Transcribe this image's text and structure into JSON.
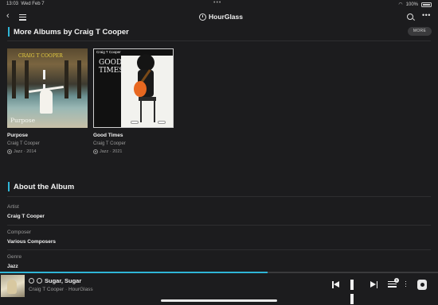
{
  "status_bar": {
    "time": "13:03",
    "date": "Wed Feb 7",
    "battery": "100%"
  },
  "top_bar": {
    "app_name": "HourGlass"
  },
  "more_albums": {
    "heading": "More Albums by Craig T Cooper",
    "more_label": "MORE",
    "albums": [
      {
        "title": "Purpose",
        "artist": "Craig T Cooper",
        "genre_year": "Jazz · 2014",
        "cover_caption": "CRAIG T COOPER",
        "cover_word": "Purpose"
      },
      {
        "title": "Good Times",
        "artist": "Craig T Cooper",
        "genre_year": "Jazz · 2021",
        "cover_caption": "Craig T Cooper",
        "cover_word": "GOOD TIMES"
      }
    ]
  },
  "about": {
    "heading": "About the Album",
    "fields": [
      {
        "label": "Artist",
        "value": "Craig T Cooper"
      },
      {
        "label": "Composer",
        "value": "Various Composers"
      },
      {
        "label": "Genre",
        "value": "Jazz"
      }
    ]
  },
  "player": {
    "title": "Sugar, Sugar",
    "subtitle": "Craig T Cooper · HourGlass",
    "progress": 0.61,
    "queue_count": "5"
  },
  "colors": {
    "accent": "#2fb5d6",
    "background": "#1c1c1e"
  }
}
